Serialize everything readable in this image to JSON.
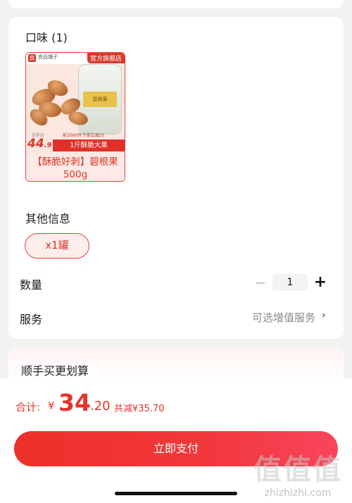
{
  "flavor": {
    "title": "口味 (1)",
    "item": {
      "brand_logo_char": "良",
      "brand_name": "良品铺子",
      "flagship_tag": "官方旗舰店",
      "jar_label": "碧根果",
      "promo_small": "到手价",
      "promo_small2": "前1000件下单立减25",
      "price_big": "44",
      "price_dec": ".9",
      "promo_bar": "1斤酥脆大果",
      "name": "【酥脆好剥】碧根果500g"
    }
  },
  "other_info": {
    "title": "其他信息",
    "chip_label": "x1罐"
  },
  "quantity": {
    "label": "数量",
    "minus": "−",
    "value": "1",
    "plus": "+"
  },
  "service": {
    "label": "服务",
    "value": "可选增值服务",
    "chevron": "›"
  },
  "upsell": {
    "title": "顺手买更划算"
  },
  "footer": {
    "total_label": "合计:",
    "currency": "¥",
    "total_int": "34",
    "total_dec": ".20",
    "saved": "共减¥35.70",
    "pay_label": "立即支付"
  },
  "watermark": {
    "big": "值值值",
    "small": "zhizhizhi.com"
  },
  "colors": {
    "accent": "#e8322b",
    "background": "#f2f2f2"
  }
}
